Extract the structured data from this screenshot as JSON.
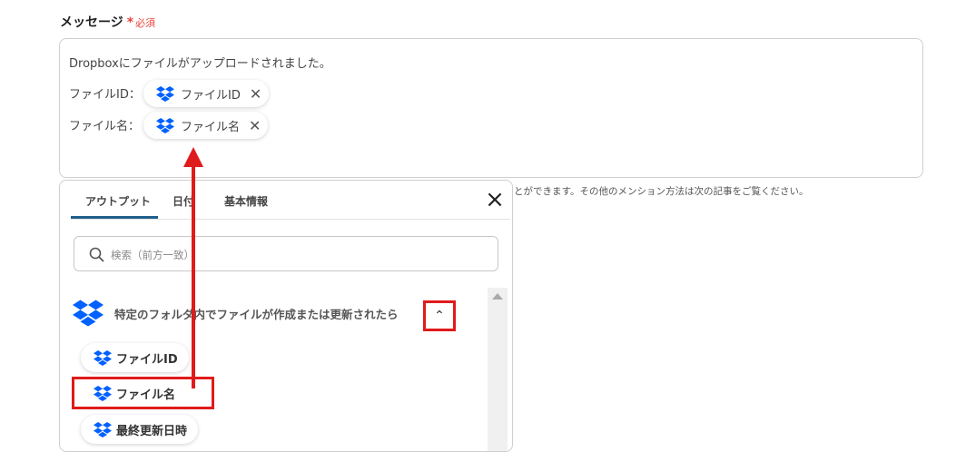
{
  "form": {
    "field_label": "メッセージ",
    "required_mark": "*",
    "required_text": "必須",
    "message_line1": "Dropboxにファイルがアップロードされました。",
    "line2_label": "ファイルID：",
    "line2_chip": "ファイルID",
    "line3_label": "ファイル名：",
    "line3_chip": "ファイル名",
    "helper_text": "とができます。その他のメンション方法は次の記事をご覧ください。"
  },
  "panel": {
    "tabs": [
      "アウトプット",
      "日付",
      "基本情報"
    ],
    "active_tab": "アウトプット",
    "close_icon": "close-icon",
    "search_placeholder": "検索（前方一致）",
    "group_title": "特定のフォルダ内でファイルが作成または更新されたら",
    "outputs": [
      "ファイルID",
      "ファイル名",
      "最終更新日時"
    ],
    "highlighted_output": "ファイル名"
  },
  "colors": {
    "required": "#e8453c",
    "highlight": "#e01b1b",
    "dropbox": "#0061fe",
    "tab_underline": "#1f5f8b"
  }
}
